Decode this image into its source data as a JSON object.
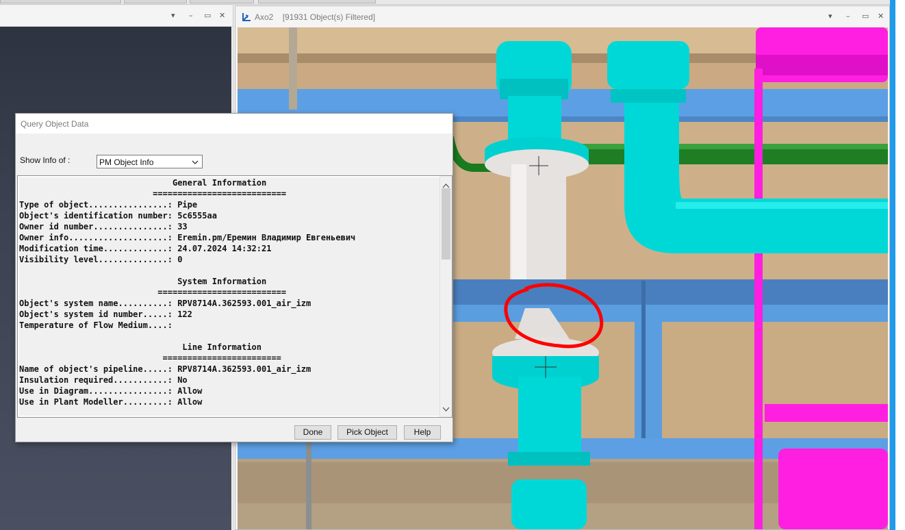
{
  "main_window": {
    "title": "Axo2",
    "filter_status": "[91931 Object(s) Filtered]"
  },
  "icons": {
    "axo_view": "axo-view-icon",
    "minimize": "minimize-icon",
    "maximize": "maximize-icon",
    "close": "close-icon",
    "dropdown": "dropdown-arrow-icon"
  },
  "pane_controls": {
    "dropdown": "▾",
    "minimize": "–",
    "maximize": "▭",
    "close": "✕"
  },
  "colors": {
    "pipe_cyan": "#00d8d8",
    "structure_magenta": "#ff1fe0",
    "pipe_green": "#1a7a1f",
    "beam_blue": "#5a9ee0",
    "annotation_red": "#ff0000",
    "selected_pipe": "#e6e2e0"
  },
  "dialog": {
    "title": "Query Object Data",
    "show_info_label": "Show Info of :",
    "show_info_value": "PM Object Info",
    "lines": [
      "                               General Information",
      "                           ===========================",
      "Type of object................: Pipe",
      "Object's identification number: 5c6555aa",
      "Owner id number...............: 33",
      "Owner info....................: Eremin.pm/Еремин Владимир Евгеньевич",
      "Modification time.............: 24.07.2024 14:32:21",
      "Visibility level..............: 0",
      "",
      "                                System Information",
      "                            ==========================",
      "Object's system name..........: RPV8714A.362593.001_air_izm",
      "Object's system id number.....: 122",
      "Temperature of Flow Medium....:",
      "",
      "                                 Line Information",
      "                             ========================",
      "Name of object's pipeline.....: RPV8714A.362593.001_air_izm",
      "Insulation required...........: No",
      "Use in Diagram................: Allow",
      "Use in Plant Modeller.........: Allow"
    ],
    "buttons": {
      "done": "Done",
      "pick_object": "Pick Object",
      "help": "Help"
    }
  }
}
